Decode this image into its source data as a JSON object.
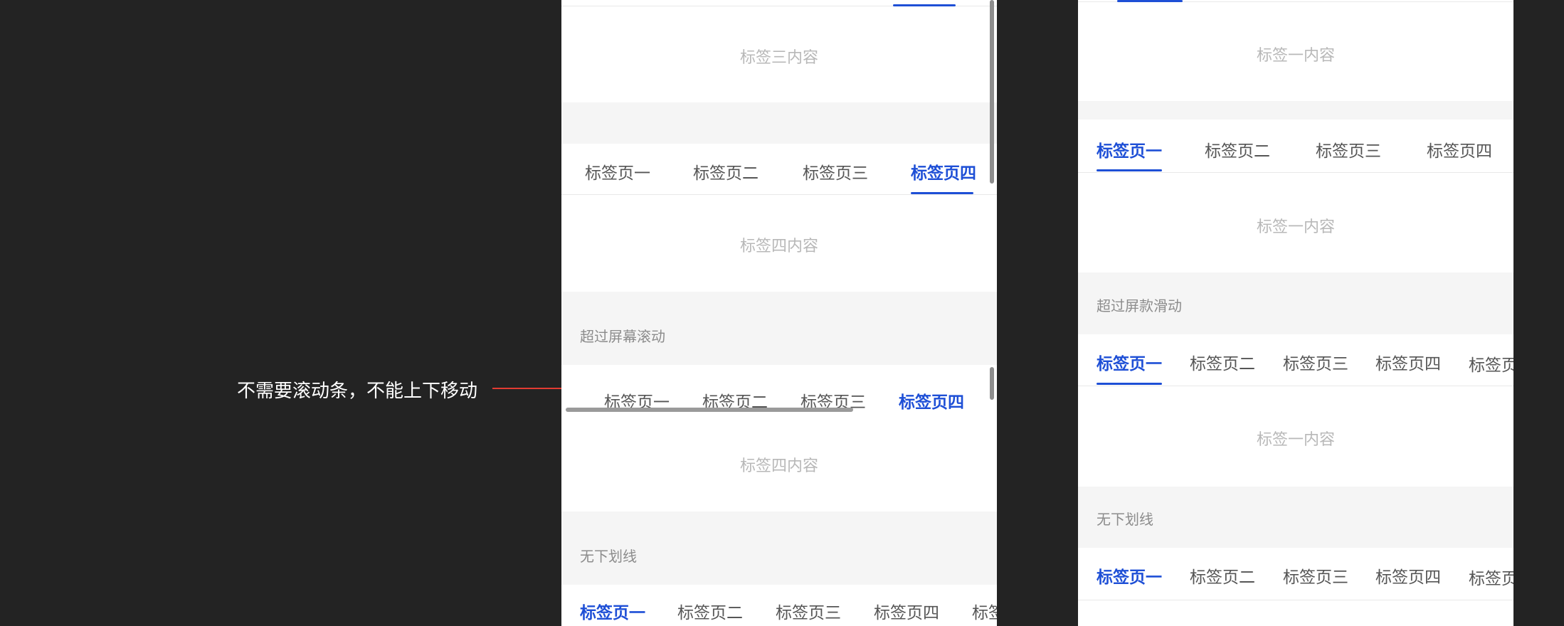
{
  "annotation": {
    "text": "不需要滚动条，不能上下移动"
  },
  "colors": {
    "active": "#1e4fd6",
    "annotation": "#e23c32",
    "background": "#232323"
  },
  "left": {
    "content1": "标签三内容",
    "tabs_equal": [
      "标签页一",
      "标签页二",
      "标签页三",
      "标签页四"
    ],
    "active_equal": 3,
    "content2": "标签四内容",
    "scroll_label": "超过屏幕滚动",
    "tabs_scroll": [
      "标签页一",
      "标签页二",
      "标签页三",
      "标签页四"
    ],
    "active_scroll": 3,
    "content3": "标签四内容",
    "nounderline_label": "无下划线",
    "tabs_nounderline": [
      "标签页一",
      "标签页二",
      "标签页三",
      "标签页四",
      "标签"
    ],
    "active_nounderline": 0
  },
  "right": {
    "content1": "标签一内容",
    "tabs_equal": [
      "标签页一",
      "标签页二",
      "标签页三",
      "标签页四"
    ],
    "active_equal": 0,
    "content2": "标签一内容",
    "scroll_label": "超过屏款滑动",
    "tabs_scroll": [
      "标签页一",
      "标签页二",
      "标签页三",
      "标签页四",
      "标签页"
    ],
    "active_scroll": 0,
    "content3": "标签一内容",
    "nounderline_label": "无下划线",
    "tabs_nounderline": [
      "标签页一",
      "标签页二",
      "标签页三",
      "标签页四",
      "标签页"
    ],
    "active_nounderline": 0
  }
}
